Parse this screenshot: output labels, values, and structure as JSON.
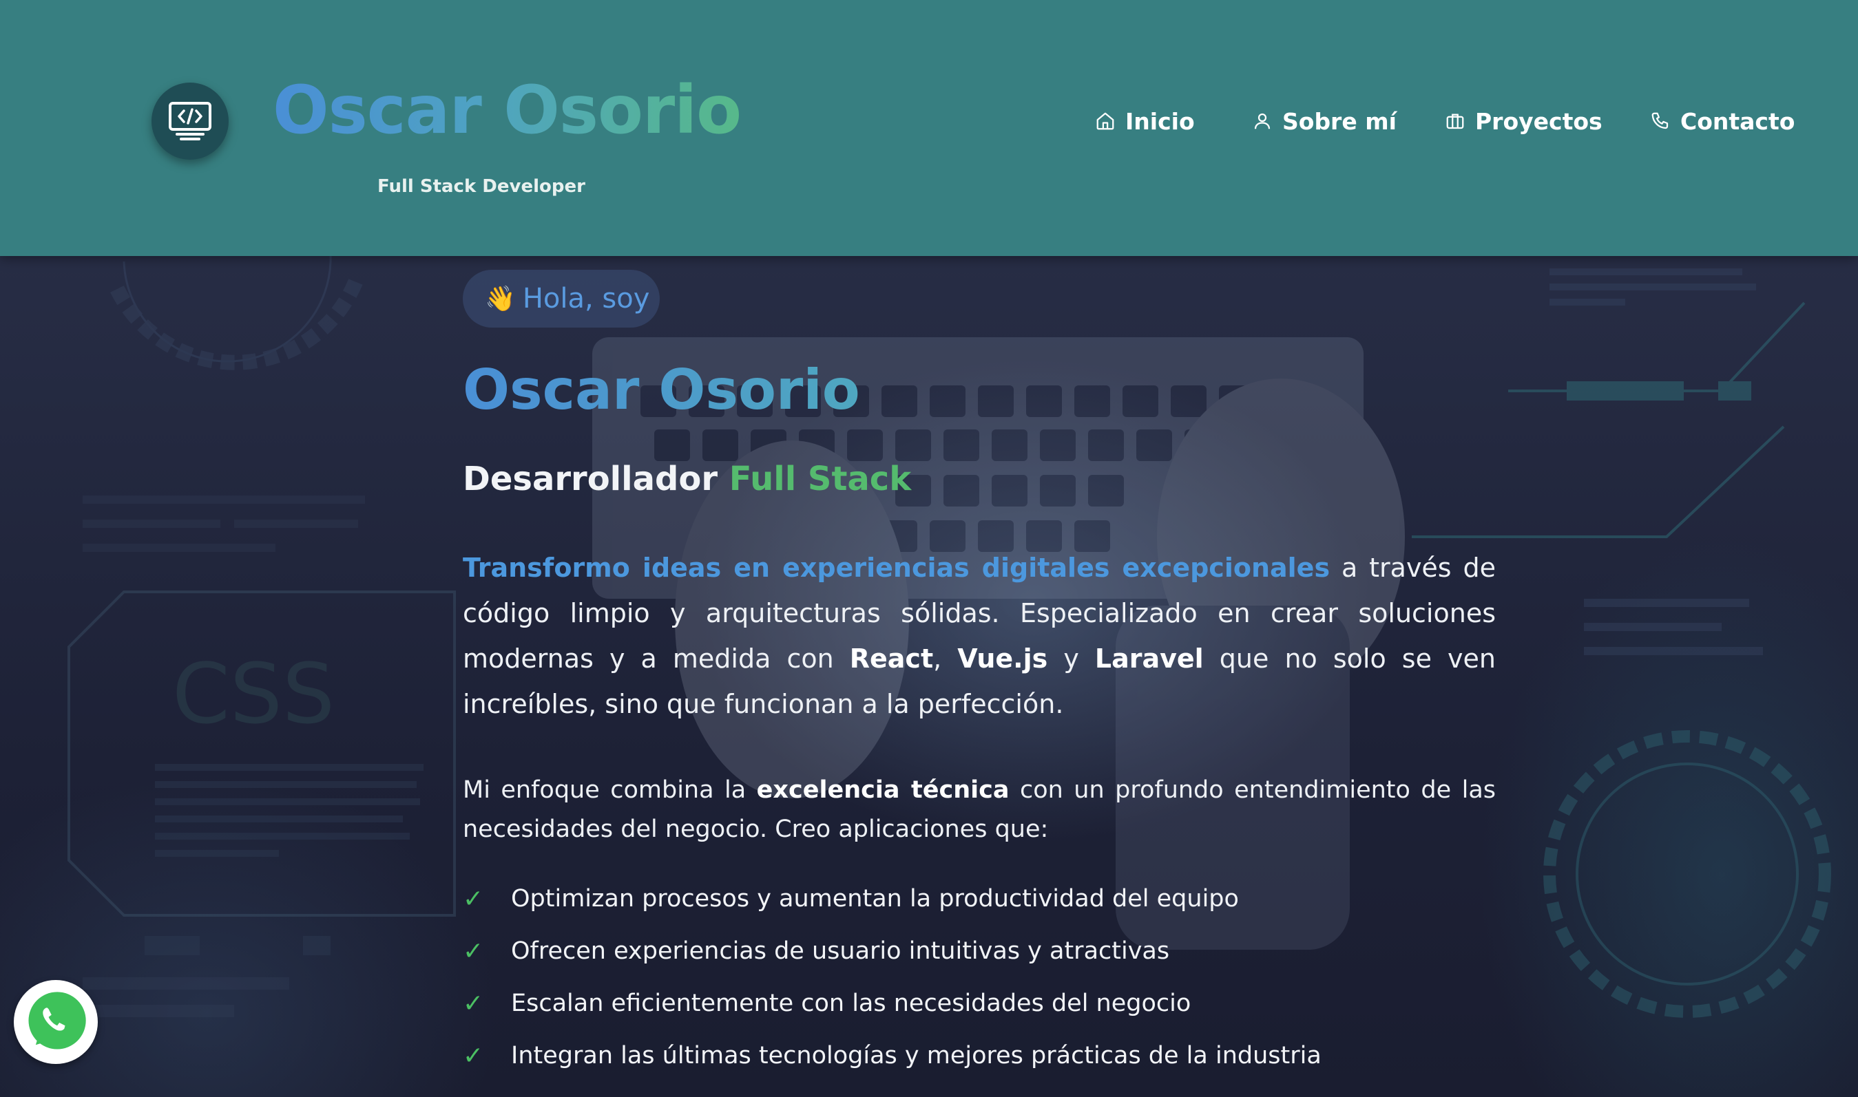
{
  "brand": {
    "name": "Oscar Osorio",
    "subtitle": "Full Stack Developer",
    "logo_icon": "monitor-code-icon"
  },
  "nav": {
    "items": [
      {
        "label": "Inicio",
        "icon": "home-icon"
      },
      {
        "label": "Sobre mí",
        "icon": "user-icon"
      },
      {
        "label": "Proyectos",
        "icon": "briefcase-icon"
      },
      {
        "label": "Contacto",
        "icon": "phone-icon"
      }
    ]
  },
  "hero": {
    "greeting_emoji": "👋",
    "greeting": "Hola, soy",
    "name": "Oscar Osorio",
    "role_prefix": "Desarrollador",
    "role_accent": "Full Stack",
    "intro_highlight": "Transformo ideas en experiencias digitales excepcionales",
    "intro_part1": " a través de código limpio y arquitecturas sólidas. Especializado en crear soluciones modernas y a medida con ",
    "tech_1": "React",
    "sep_1": ", ",
    "tech_2": "Vue.js",
    "sep_2": " y ",
    "tech_3": "Laravel",
    "intro_part2": " que no solo se ven increíbles, sino que funcionan a la perfección.",
    "approach_part1": "Mi enfoque combina la ",
    "approach_bold": "excelencia técnica",
    "approach_part2": " con un profundo entendimiento de las necesidades del negocio. Creo aplicaciones que:",
    "benefits": [
      "Optimizan procesos y aumentan la productividad del equipo",
      "Ofrecen experiencias de usuario intuitivas y atractivas",
      "Escalan eficientemente con las necesidades del negocio",
      "Integran las últimas tecnologías y mejores prácticas de la industria"
    ],
    "check_symbol": "✓"
  },
  "background": {
    "css_label": "CSS"
  },
  "whatsapp": {
    "icon": "whatsapp-icon"
  },
  "colors": {
    "header_bg": "#377f81",
    "accent_blue": "#4c98de",
    "accent_green": "#55bb6e",
    "hero_bg": "#1c2033"
  }
}
